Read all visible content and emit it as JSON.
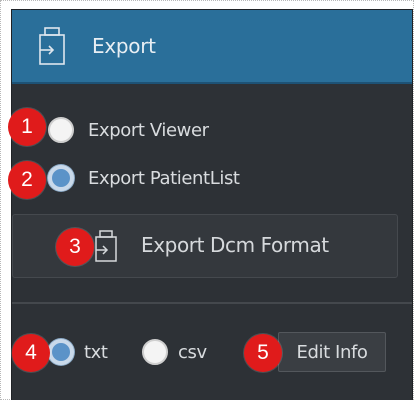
{
  "header": {
    "title": "Export",
    "icon": "export-icon"
  },
  "export_mode": {
    "options": [
      {
        "label": "Export Viewer",
        "selected": false
      },
      {
        "label": "Export PatientList",
        "selected": true
      }
    ]
  },
  "dcm_button": {
    "label": "Export Dcm Format",
    "icon": "export-icon"
  },
  "file_format": {
    "options": [
      {
        "label": "txt",
        "selected": true
      },
      {
        "label": "csv",
        "selected": false
      }
    ]
  },
  "edit_info_button": {
    "label": "Edit Info"
  },
  "annotations": {
    "badges": [
      "1",
      "2",
      "3",
      "4",
      "5"
    ]
  },
  "colors": {
    "header_bg": "#2a6f9a",
    "panel_bg": "#2d3136",
    "badge_red": "#e01b1b",
    "radio_selected": "#5b93c8"
  }
}
